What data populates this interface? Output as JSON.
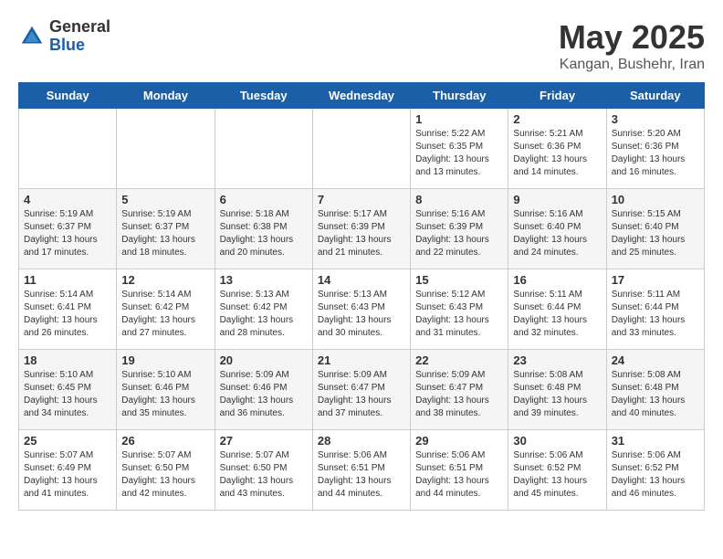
{
  "logo": {
    "general": "General",
    "blue": "Blue"
  },
  "title": "May 2025",
  "location": "Kangan, Bushehr, Iran",
  "days_of_week": [
    "Sunday",
    "Monday",
    "Tuesday",
    "Wednesday",
    "Thursday",
    "Friday",
    "Saturday"
  ],
  "weeks": [
    [
      {
        "day": "",
        "content": ""
      },
      {
        "day": "",
        "content": ""
      },
      {
        "day": "",
        "content": ""
      },
      {
        "day": "",
        "content": ""
      },
      {
        "day": "1",
        "content": "Sunrise: 5:22 AM\nSunset: 6:35 PM\nDaylight: 13 hours\nand 13 minutes."
      },
      {
        "day": "2",
        "content": "Sunrise: 5:21 AM\nSunset: 6:36 PM\nDaylight: 13 hours\nand 14 minutes."
      },
      {
        "day": "3",
        "content": "Sunrise: 5:20 AM\nSunset: 6:36 PM\nDaylight: 13 hours\nand 16 minutes."
      }
    ],
    [
      {
        "day": "4",
        "content": "Sunrise: 5:19 AM\nSunset: 6:37 PM\nDaylight: 13 hours\nand 17 minutes."
      },
      {
        "day": "5",
        "content": "Sunrise: 5:19 AM\nSunset: 6:37 PM\nDaylight: 13 hours\nand 18 minutes."
      },
      {
        "day": "6",
        "content": "Sunrise: 5:18 AM\nSunset: 6:38 PM\nDaylight: 13 hours\nand 20 minutes."
      },
      {
        "day": "7",
        "content": "Sunrise: 5:17 AM\nSunset: 6:39 PM\nDaylight: 13 hours\nand 21 minutes."
      },
      {
        "day": "8",
        "content": "Sunrise: 5:16 AM\nSunset: 6:39 PM\nDaylight: 13 hours\nand 22 minutes."
      },
      {
        "day": "9",
        "content": "Sunrise: 5:16 AM\nSunset: 6:40 PM\nDaylight: 13 hours\nand 24 minutes."
      },
      {
        "day": "10",
        "content": "Sunrise: 5:15 AM\nSunset: 6:40 PM\nDaylight: 13 hours\nand 25 minutes."
      }
    ],
    [
      {
        "day": "11",
        "content": "Sunrise: 5:14 AM\nSunset: 6:41 PM\nDaylight: 13 hours\nand 26 minutes."
      },
      {
        "day": "12",
        "content": "Sunrise: 5:14 AM\nSunset: 6:42 PM\nDaylight: 13 hours\nand 27 minutes."
      },
      {
        "day": "13",
        "content": "Sunrise: 5:13 AM\nSunset: 6:42 PM\nDaylight: 13 hours\nand 28 minutes."
      },
      {
        "day": "14",
        "content": "Sunrise: 5:13 AM\nSunset: 6:43 PM\nDaylight: 13 hours\nand 30 minutes."
      },
      {
        "day": "15",
        "content": "Sunrise: 5:12 AM\nSunset: 6:43 PM\nDaylight: 13 hours\nand 31 minutes."
      },
      {
        "day": "16",
        "content": "Sunrise: 5:11 AM\nSunset: 6:44 PM\nDaylight: 13 hours\nand 32 minutes."
      },
      {
        "day": "17",
        "content": "Sunrise: 5:11 AM\nSunset: 6:44 PM\nDaylight: 13 hours\nand 33 minutes."
      }
    ],
    [
      {
        "day": "18",
        "content": "Sunrise: 5:10 AM\nSunset: 6:45 PM\nDaylight: 13 hours\nand 34 minutes."
      },
      {
        "day": "19",
        "content": "Sunrise: 5:10 AM\nSunset: 6:46 PM\nDaylight: 13 hours\nand 35 minutes."
      },
      {
        "day": "20",
        "content": "Sunrise: 5:09 AM\nSunset: 6:46 PM\nDaylight: 13 hours\nand 36 minutes."
      },
      {
        "day": "21",
        "content": "Sunrise: 5:09 AM\nSunset: 6:47 PM\nDaylight: 13 hours\nand 37 minutes."
      },
      {
        "day": "22",
        "content": "Sunrise: 5:09 AM\nSunset: 6:47 PM\nDaylight: 13 hours\nand 38 minutes."
      },
      {
        "day": "23",
        "content": "Sunrise: 5:08 AM\nSunset: 6:48 PM\nDaylight: 13 hours\nand 39 minutes."
      },
      {
        "day": "24",
        "content": "Sunrise: 5:08 AM\nSunset: 6:48 PM\nDaylight: 13 hours\nand 40 minutes."
      }
    ],
    [
      {
        "day": "25",
        "content": "Sunrise: 5:07 AM\nSunset: 6:49 PM\nDaylight: 13 hours\nand 41 minutes."
      },
      {
        "day": "26",
        "content": "Sunrise: 5:07 AM\nSunset: 6:50 PM\nDaylight: 13 hours\nand 42 minutes."
      },
      {
        "day": "27",
        "content": "Sunrise: 5:07 AM\nSunset: 6:50 PM\nDaylight: 13 hours\nand 43 minutes."
      },
      {
        "day": "28",
        "content": "Sunrise: 5:06 AM\nSunset: 6:51 PM\nDaylight: 13 hours\nand 44 minutes."
      },
      {
        "day": "29",
        "content": "Sunrise: 5:06 AM\nSunset: 6:51 PM\nDaylight: 13 hours\nand 44 minutes."
      },
      {
        "day": "30",
        "content": "Sunrise: 5:06 AM\nSunset: 6:52 PM\nDaylight: 13 hours\nand 45 minutes."
      },
      {
        "day": "31",
        "content": "Sunrise: 5:06 AM\nSunset: 6:52 PM\nDaylight: 13 hours\nand 46 minutes."
      }
    ]
  ]
}
